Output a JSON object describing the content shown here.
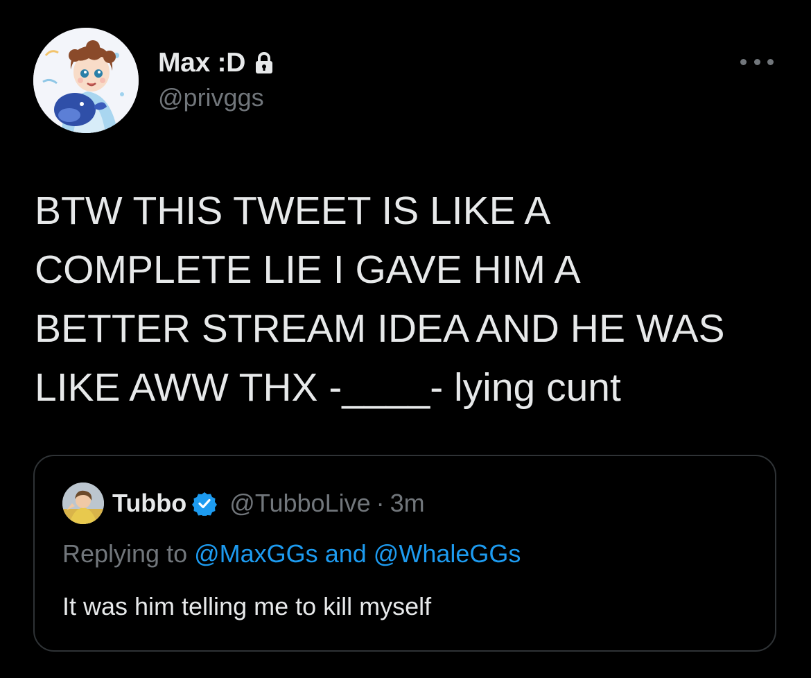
{
  "author": {
    "display_name": "Max :D",
    "handle": "@privggs",
    "avatar_icon": "cartoon-avatar",
    "protected_icon": "lock-icon"
  },
  "tweet": {
    "lines": [
      "BTW THIS TWEET IS LIKE A",
      "COMPLETE LIE I GAVE HIM A",
      "BETTER STREAM IDEA AND HE WAS",
      "LIKE AWW THX -____- lying cunt"
    ]
  },
  "quoted_tweet": {
    "display_name": "Tubbo",
    "verified_icon": "verified-badge-icon",
    "handle": "@TubboLive",
    "separator": "·",
    "time": "3m",
    "replying_prefix": "Replying to",
    "mention_1": "@MaxGGs",
    "and_word": "and",
    "mention_2": "@WhaleGGs",
    "text": "It was him telling me to kill myself"
  },
  "colors": {
    "background": "#000000",
    "text_primary": "#e7e9ea",
    "text_secondary": "#71767b",
    "accent": "#1d9bf0",
    "border": "#2f3336"
  }
}
